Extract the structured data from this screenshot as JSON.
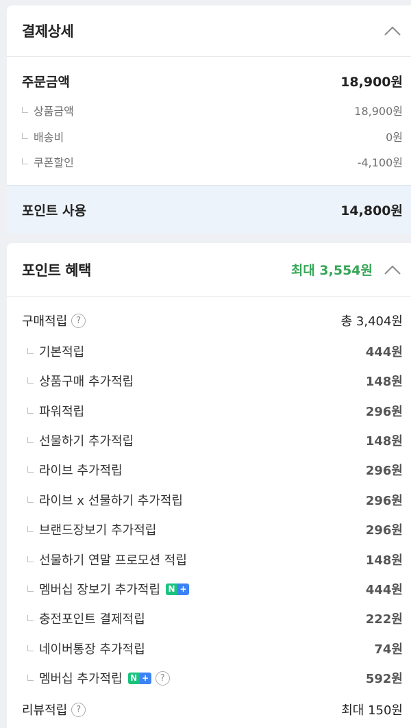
{
  "payment": {
    "title": "결제상세",
    "order_amount": {
      "label": "주문금액",
      "value": "18,900원"
    },
    "items": [
      {
        "label": "상품금액",
        "value": "18,900원"
      },
      {
        "label": "배송비",
        "value": "0원"
      },
      {
        "label": "쿠폰할인",
        "value": "-4,100원"
      }
    ],
    "point_use": {
      "label": "포인트 사용",
      "value": "14,800원"
    }
  },
  "benefits": {
    "title": "포인트 혜택",
    "max_label": "최대 3,554원",
    "purchase": {
      "label": "구매적립",
      "value": "총 3,404원"
    },
    "items": [
      {
        "label": "기본적립",
        "value": "444원"
      },
      {
        "label": "상품구매 추가적립",
        "value": "148원"
      },
      {
        "label": "파워적립",
        "value": "296원"
      },
      {
        "label": "선물하기 추가적립",
        "value": "148원"
      },
      {
        "label": "라이브 추가적립",
        "value": "296원"
      },
      {
        "label": "라이브 x 선물하기 추가적립",
        "value": "296원"
      },
      {
        "label": "브랜드장보기 추가적립",
        "value": "296원"
      },
      {
        "label": "선물하기 연말 프로모션 적립",
        "value": "148원"
      },
      {
        "label": "멤버십 장보기 추가적립",
        "value": "444원"
      },
      {
        "label": "충전포인트 결제적립",
        "value": "222원"
      },
      {
        "label": "네이버통장 추가적립",
        "value": "74원"
      },
      {
        "label": "멤버십 추가적립",
        "value": "592원"
      }
    ],
    "review": {
      "label": "리뷰적립",
      "value": "최대 150원"
    }
  },
  "badge": {
    "n": "N",
    "plus": "+"
  },
  "help_glyph": "?",
  "colors": {
    "accent_green": "#36a657",
    "highlight_bg": "#edf3fa",
    "page_bg": "#eef0f3"
  }
}
